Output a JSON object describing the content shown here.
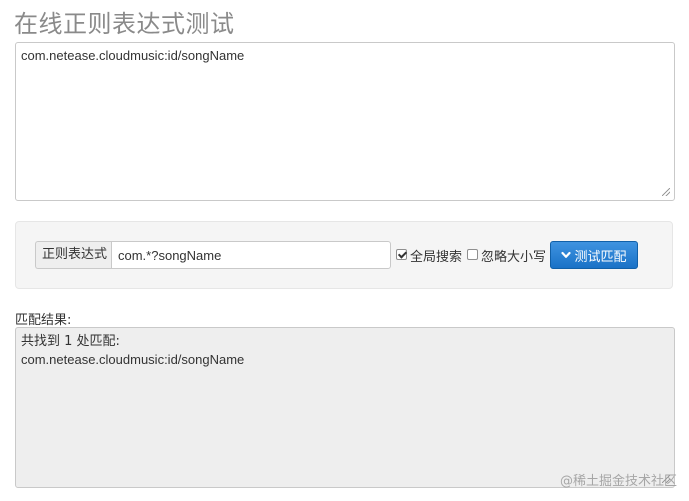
{
  "page": {
    "title": "在线正则表达式测试"
  },
  "source": {
    "value": "com.netease.cloudmusic:id/songName"
  },
  "regex_panel": {
    "addon_label": "正则表达式",
    "pattern": "com.*?songName",
    "global_search": {
      "label": "全局搜索",
      "checked": true
    },
    "ignore_case": {
      "label": "忽略大小写",
      "checked": false
    },
    "test_button": {
      "label": "测试匹配",
      "icon": "chevron-down-icon"
    }
  },
  "result": {
    "label": "匹配结果:",
    "summary": "共找到 1 处匹配:",
    "matches": [
      "com.netease.cloudmusic:id/songName"
    ]
  },
  "watermark": "@稀土掘金技术社区",
  "colors": {
    "button_blue": "#1a72c7",
    "panel_bg": "#f5f5f5",
    "result_bg": "#eeeeee",
    "title": "#8a8a8a"
  }
}
